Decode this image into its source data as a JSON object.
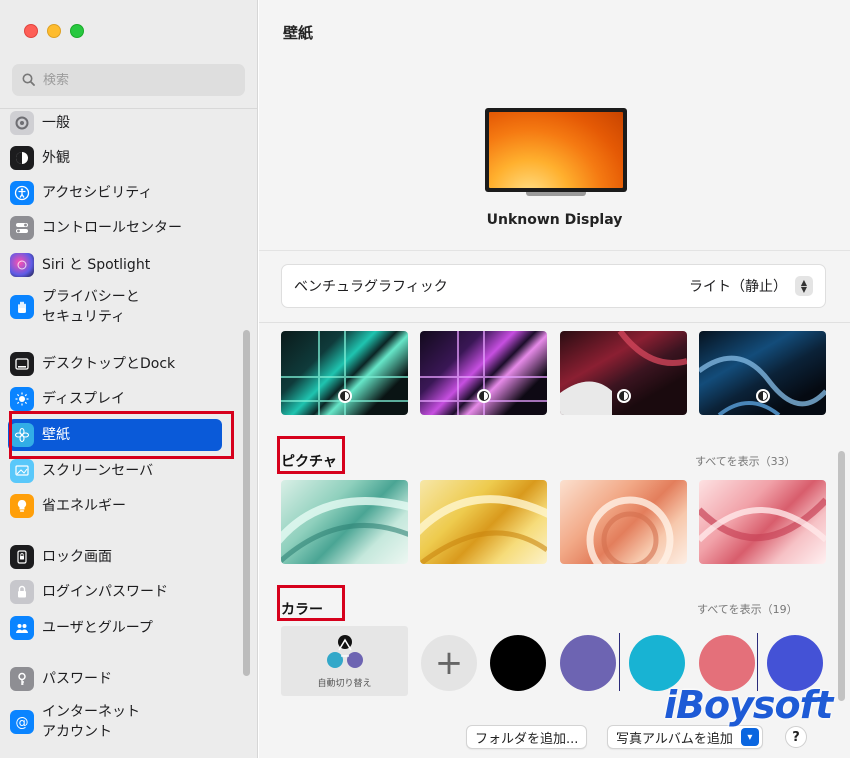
{
  "window": {
    "title": "壁紙"
  },
  "sidebar": {
    "search_placeholder": "検索",
    "items": [
      {
        "label": "一般",
        "icon": "gear-icon",
        "color": "#8e8e93"
      },
      {
        "label": "外観",
        "icon": "appearance-icon",
        "color": "#1c1c1e"
      },
      {
        "label": "アクセシビリティ",
        "icon": "accessibility-icon",
        "color": "#0a84ff"
      },
      {
        "label": "コントロールセンター",
        "icon": "control-center-icon",
        "color": "#8e8e93"
      },
      {
        "label": "Siri と Spotlight",
        "icon": "siri-icon",
        "color": "#5e5ce6"
      },
      {
        "label": "プライバシーと\nセキュリティ",
        "icon": "hand-icon",
        "color": "#0a84ff"
      },
      {
        "label": "デスクトップとDock",
        "icon": "dock-icon",
        "color": "#1c1c1e"
      },
      {
        "label": "ディスプレイ",
        "icon": "sun-icon",
        "color": "#0a84ff"
      },
      {
        "label": "壁紙",
        "icon": "flower-icon",
        "color": "#32ade6"
      },
      {
        "label": "スクリーンセーバ",
        "icon": "screensaver-icon",
        "color": "#5ac8fa"
      },
      {
        "label": "省エネルギー",
        "icon": "bulb-icon",
        "color": "#ff9f0a"
      },
      {
        "label": "ロック画面",
        "icon": "lock-screen-icon",
        "color": "#1c1c1e"
      },
      {
        "label": "ログインパスワード",
        "icon": "lock-icon",
        "color": "#8e8e93"
      },
      {
        "label": "ユーザとグループ",
        "icon": "users-icon",
        "color": "#0a84ff"
      },
      {
        "label": "パスワード",
        "icon": "key-icon",
        "color": "#8e8e93"
      },
      {
        "label": "インターネット\nアカウント",
        "icon": "at-icon",
        "color": "#0a84ff"
      }
    ]
  },
  "main": {
    "title": "壁紙",
    "display_name": "Unknown Display",
    "wallpaper_name": "ベンチュラグラフィック",
    "wallpaper_mode": "ライト（静止）",
    "pictures": {
      "title": "ピクチャ",
      "show_all": "すべてを表示（33）"
    },
    "colors": {
      "title": "カラー",
      "show_all": "すべてを表示（19）",
      "auto_label": "自動切り替え",
      "plus": "+",
      "swatches": [
        "#000000",
        "#6d64b2",
        "#18b3d3",
        "#e4707a",
        "#4452d6"
      ]
    },
    "buttons": {
      "add_folder": "フォルダを追加...",
      "add_album": "写真アルバムを追加",
      "help": "?"
    }
  },
  "watermark": "iBoysoft",
  "colors": {
    "selection": "#0a5ad9",
    "annotation": "#d6001c"
  }
}
